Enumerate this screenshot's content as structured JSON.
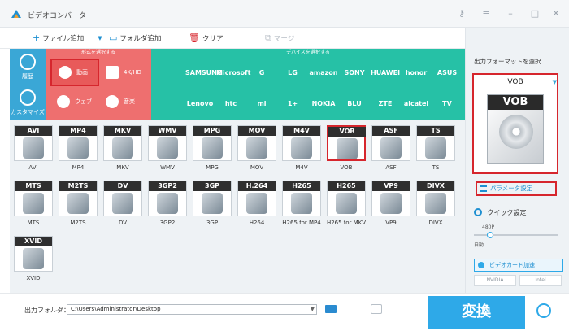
{
  "app": {
    "title": "ビデオコンバータ",
    "convert_label": "変換"
  },
  "toolbar": {
    "add_file": "ファイル追加",
    "add_folder": "フォルダ追加",
    "clear": "クリア",
    "merge": "マージ"
  },
  "nav": {
    "history": "履歴",
    "customize": "カスタマイズ"
  },
  "categories": {
    "header": "形式を選択する",
    "items": [
      {
        "label": "動画",
        "icon": "play-icon"
      },
      {
        "label": "4K/HD",
        "icon": "4k-icon"
      },
      {
        "label": "ウェブ",
        "icon": "web-icon"
      },
      {
        "label": "音楽",
        "icon": "music-icon"
      }
    ]
  },
  "devices": {
    "header": "デバイスを選択する",
    "items": [
      "",
      "SAMSUNG",
      "Microsoft",
      "G",
      "LG",
      "amazon",
      "SONY",
      "HUAWEI",
      "honor",
      "ASUS",
      "",
      "Lenovo",
      "htc",
      "mi",
      "1+",
      "NOKIA",
      "BLU",
      "ZTE",
      "alcatel",
      "TV"
    ]
  },
  "formats": [
    {
      "badge": "AVI",
      "label": "AVI"
    },
    {
      "badge": "MP4",
      "label": "MP4"
    },
    {
      "badge": "MKV",
      "label": "MKV"
    },
    {
      "badge": "WMV",
      "label": "WMV"
    },
    {
      "badge": "MPG",
      "label": "MPG"
    },
    {
      "badge": "MOV",
      "label": "MOV"
    },
    {
      "badge": "M4V",
      "label": "M4V"
    },
    {
      "badge": "VOB",
      "label": "VOB",
      "selected": true
    },
    {
      "badge": "ASF",
      "label": "ASF"
    },
    {
      "badge": "TS",
      "label": "TS"
    },
    {
      "badge": "MTS",
      "label": "MTS"
    },
    {
      "badge": "M2TS",
      "label": "M2TS"
    },
    {
      "badge": "DV",
      "label": "DV"
    },
    {
      "badge": "3GP2",
      "label": "3GP2"
    },
    {
      "badge": "3GP",
      "label": "3GP"
    },
    {
      "badge": "H.264",
      "label": "H264"
    },
    {
      "badge": "H265",
      "label": "H265 for MP4"
    },
    {
      "badge": "H265",
      "label": "H265 for MKV"
    },
    {
      "badge": "VP9",
      "label": "VP9"
    },
    {
      "badge": "DIVX",
      "label": "DIVX"
    },
    {
      "badge": "XVID",
      "label": "XVID"
    }
  ],
  "output": {
    "label": "出力フォルダ：",
    "path": "C:\\Users\\Administrator\\Desktop"
  },
  "right_panel": {
    "title": "出力フォーマットを選択",
    "selected_format": "VOB",
    "param_settings": "パラメータ設定",
    "quick_settings": "クイック設定",
    "slider_tick": "480P",
    "auto": "自動",
    "gpu_accel": "ビデオカード加速",
    "vendors": [
      "NVIDIA",
      "Intel"
    ]
  },
  "colors": {
    "accent": "#2ea9e8",
    "category_red": "#ee6f6f",
    "device_teal": "#26c1a6",
    "highlight_red": "#d6262d"
  }
}
